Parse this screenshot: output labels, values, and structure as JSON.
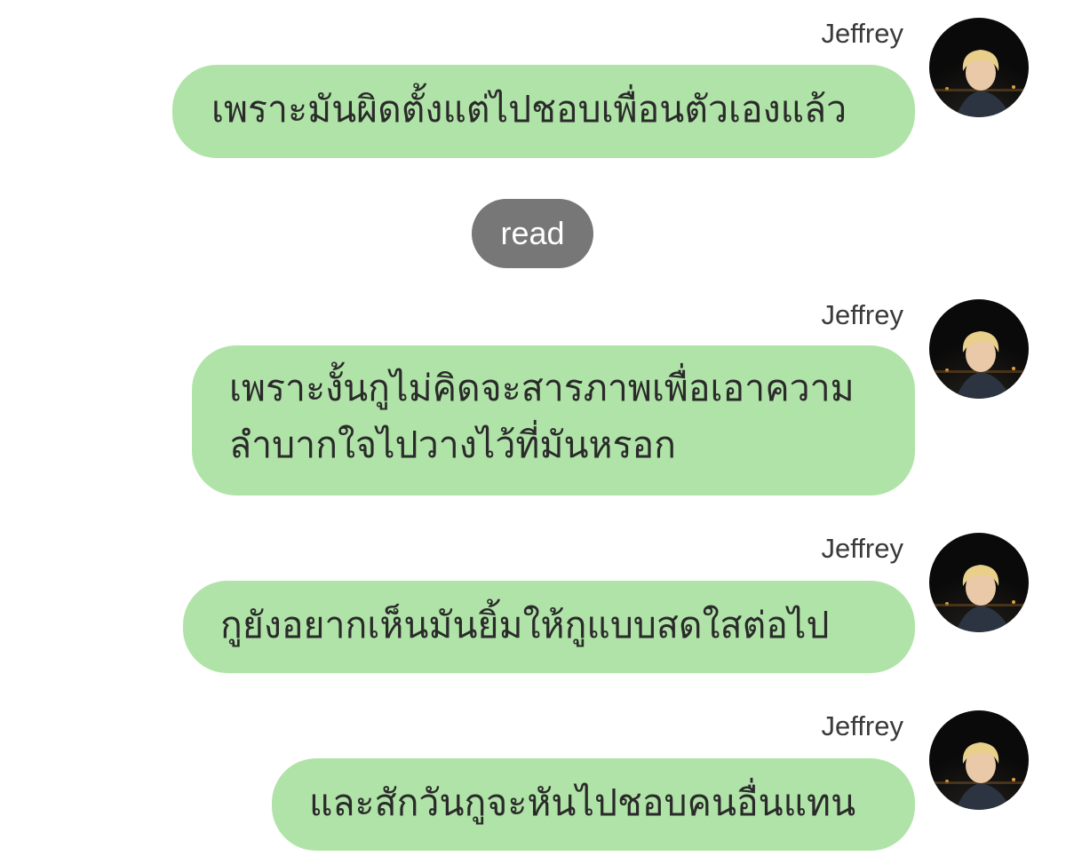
{
  "read_indicator": "read",
  "messages": [
    {
      "sender": "Jeffrey",
      "text": "เพราะมันผิดตั้งแต่ไปชอบเพื่อนตัวเองแล้ว",
      "avatar_icon": "user-avatar-photo"
    },
    {
      "sender": "Jeffrey",
      "text": "เพราะงั้นกูไม่คิดจะสารภาพเพื่อเอาความ\nลำบากใจไปวางไว้ที่มันหรอก",
      "avatar_icon": "user-avatar-photo"
    },
    {
      "sender": "Jeffrey",
      "text": "กูยังอยากเห็นมันยิ้มให้กูแบบสดใสต่อไป",
      "avatar_icon": "user-avatar-photo"
    },
    {
      "sender": "Jeffrey",
      "text": "และสักวันกูจะหันไปชอบคนอื่นแทน",
      "avatar_icon": "user-avatar-photo"
    }
  ],
  "colors": {
    "bubble": "#b0e3a7",
    "read_pill": "#777777",
    "text": "#2a2a2a"
  }
}
